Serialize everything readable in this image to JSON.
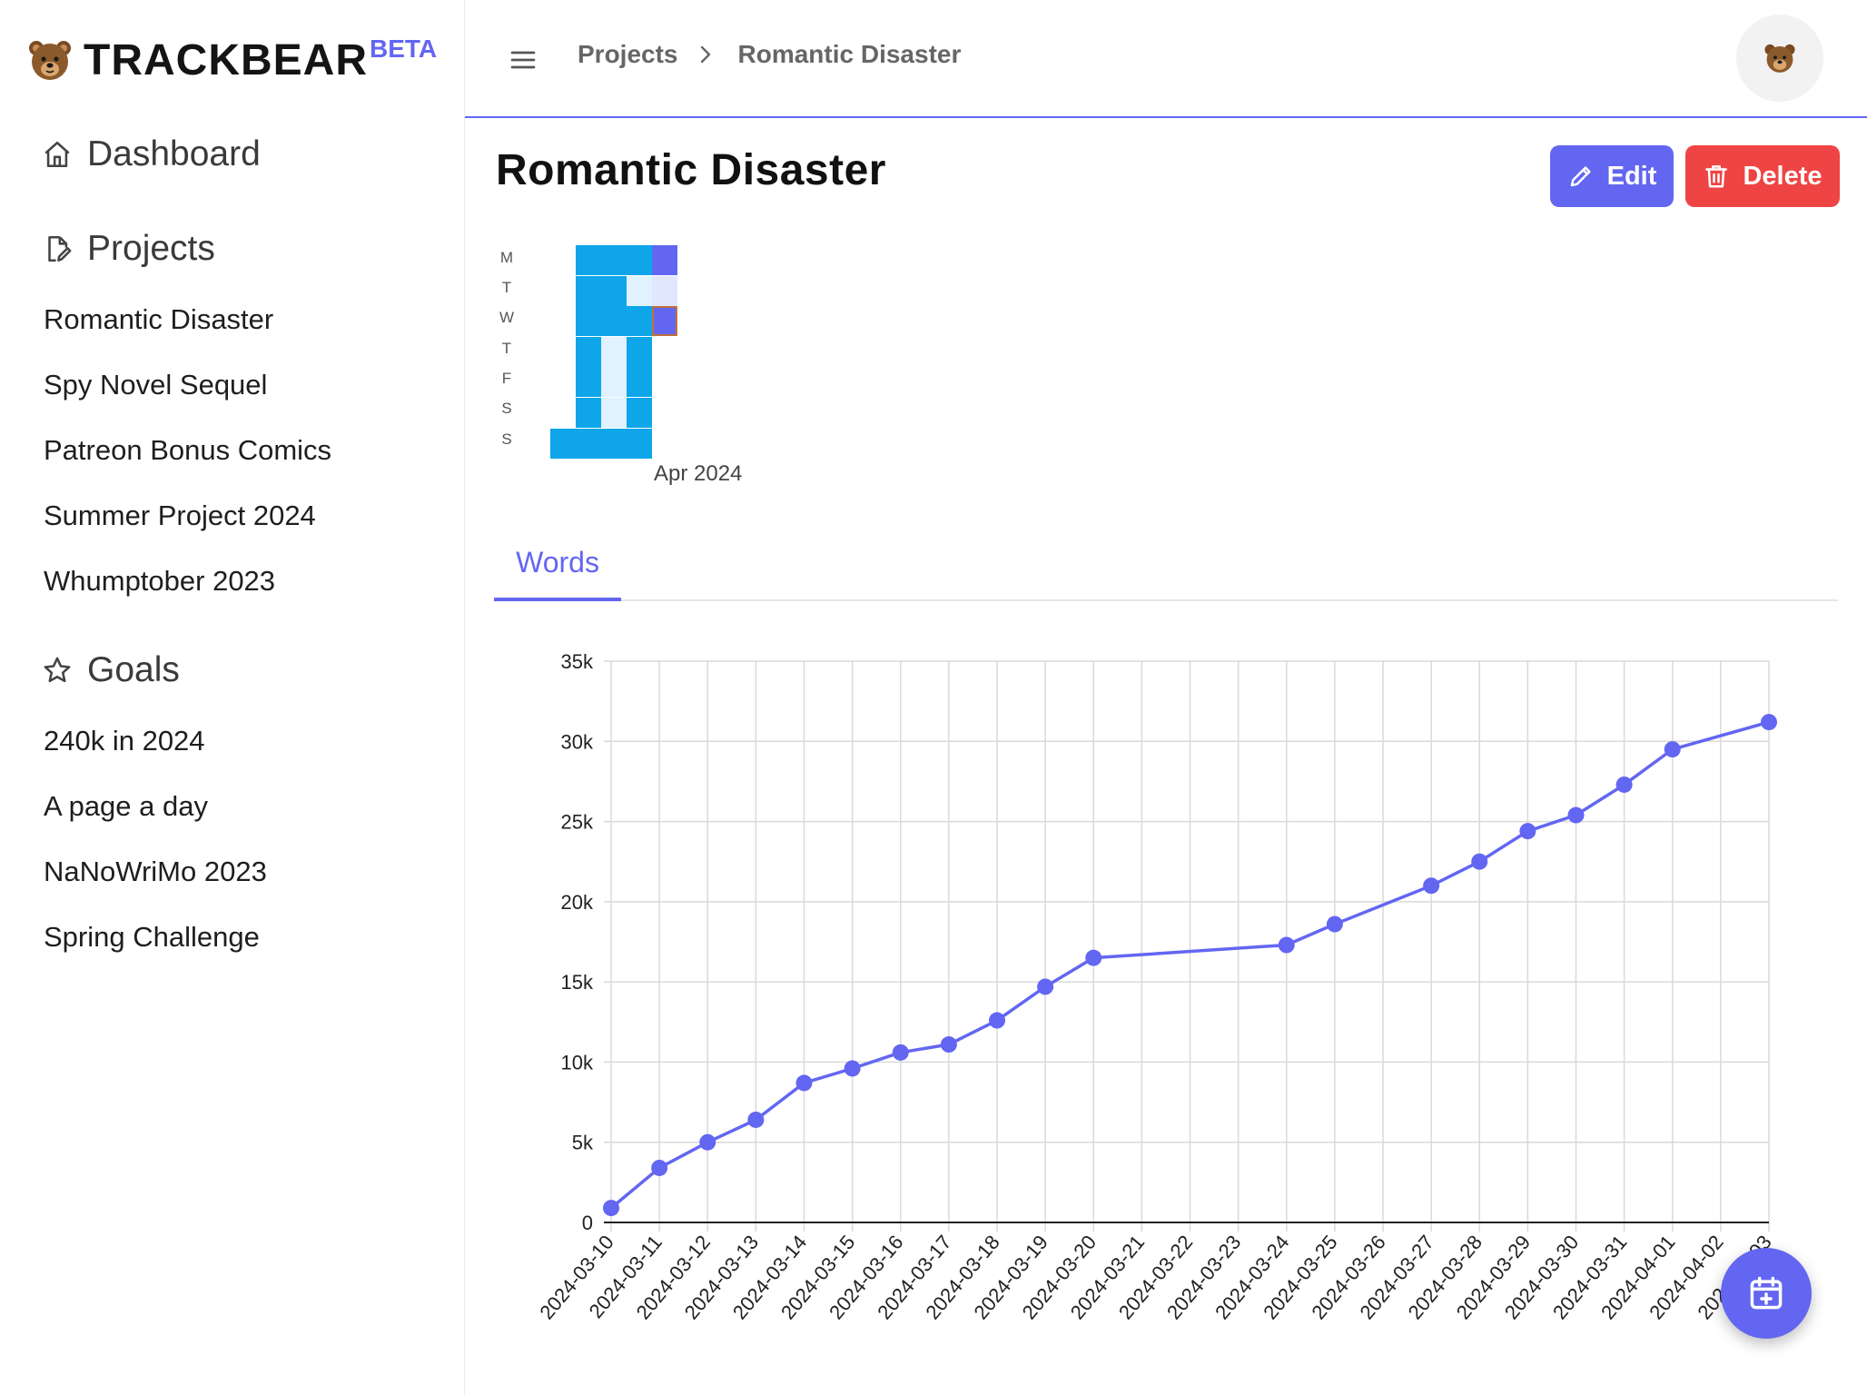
{
  "brand": {
    "name": "TRACKBEAR",
    "badge": "BETA"
  },
  "sidebar": {
    "dashboard_label": "Dashboard",
    "projects_label": "Projects",
    "projects": [
      "Romantic Disaster",
      "Spy Novel Sequel",
      "Patreon Bonus Comics",
      "Summer Project 2024",
      "Whumptober 2023"
    ],
    "goals_label": "Goals",
    "goals": [
      "240k in 2024",
      "A page a day",
      "NaNoWriMo 2023",
      "Spring Challenge"
    ]
  },
  "header": {
    "breadcrumbs": [
      "Projects",
      "Romantic Disaster"
    ]
  },
  "page": {
    "title": "Romantic Disaster",
    "edit_label": "Edit",
    "delete_label": "Delete"
  },
  "heatmap": {
    "day_labels": [
      "M",
      "T",
      "W",
      "T",
      "F",
      "S",
      "S"
    ],
    "month_label": "Apr 2024"
  },
  "tabs": [
    "Words"
  ],
  "colors": {
    "accent": "#6366f1",
    "danger": "#ef4444",
    "heat_high": "#0ea5e9",
    "heat_low": "#e0f2fe",
    "grid": "#d9d9d9"
  },
  "chart_data": {
    "type": "line",
    "x": [
      "2024-03-10",
      "2024-03-11",
      "2024-03-12",
      "2024-03-13",
      "2024-03-14",
      "2024-03-15",
      "2024-03-16",
      "2024-03-17",
      "2024-03-18",
      "2024-03-19",
      "2024-03-20",
      "2024-03-21",
      "2024-03-22",
      "2024-03-23",
      "2024-03-24",
      "2024-03-25",
      "2024-03-26",
      "2024-03-27",
      "2024-03-28",
      "2024-03-29",
      "2024-03-30",
      "2024-03-31",
      "2024-04-01",
      "2024-04-02",
      "2024-04-03"
    ],
    "series": [
      {
        "values": [
          900,
          3400,
          5000,
          6400,
          8700,
          9600,
          10600,
          11100,
          12600,
          14700,
          16500,
          null,
          null,
          null,
          17300,
          18600,
          null,
          21000,
          22500,
          24400,
          25400,
          27300,
          29500,
          null,
          31200
        ]
      }
    ],
    "yticks": [
      "0",
      "5k",
      "10k",
      "15k",
      "20k",
      "25k",
      "30k",
      "35k"
    ],
    "ylim": [
      0,
      35000
    ]
  }
}
